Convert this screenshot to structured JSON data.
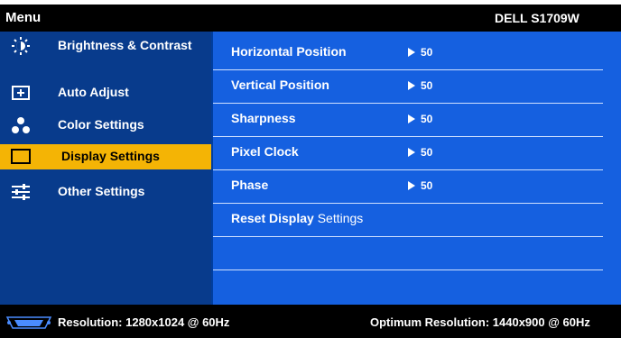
{
  "header": {
    "menu": "Menu",
    "model": "DELL S1709W"
  },
  "nav": [
    {
      "label": "Brightness & Contrast",
      "icon": "brightness-icon"
    },
    {
      "label": "Auto Adjust",
      "icon": "auto-adjust-icon"
    },
    {
      "label": "Color Settings",
      "icon": "color-settings-icon"
    },
    {
      "label": "Display Settings",
      "icon": "display-settings-icon",
      "selected": true
    },
    {
      "label": "Other Settings",
      "icon": "other-settings-icon"
    }
  ],
  "settings": [
    {
      "label": "Horizontal Position",
      "value": "50"
    },
    {
      "label": "Vertical Position",
      "value": "50"
    },
    {
      "label": "Sharpness",
      "value": "50"
    },
    {
      "label": "Pixel Clock",
      "value": "50"
    },
    {
      "label": "Phase",
      "value": "50"
    }
  ],
  "reset": {
    "bold": "Reset Display",
    "normal": " Settings"
  },
  "footer": {
    "resolution": "Resolution: 1280x1024 @ 60Hz",
    "optimum": "Optimum Resolution: 1440x900 @ 60Hz",
    "input_icon": "vga-connector-icon"
  },
  "colors": {
    "header_bg": "#000000",
    "nav_bg": "#083b8c",
    "panel_bg": "#1560e0",
    "selected_bg": "#f4b405"
  }
}
